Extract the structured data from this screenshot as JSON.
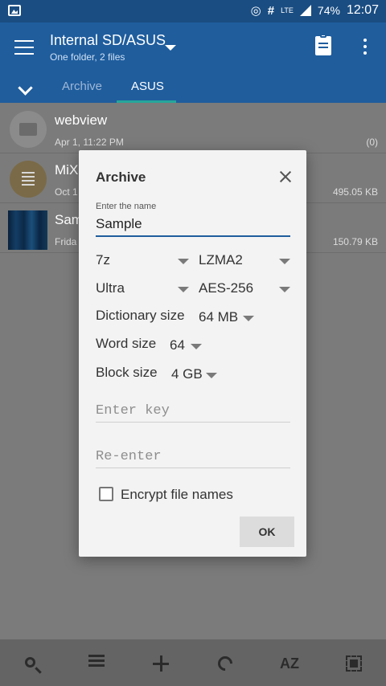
{
  "status_bar": {
    "battery": "74%",
    "time": "12:07",
    "network": "LTE",
    "indicators": [
      "wifi-hotspot-icon",
      "hash-icon",
      "signal-icon"
    ]
  },
  "app_bar": {
    "title": "Internal SD/ASUS",
    "subtitle": "One folder, 2 files",
    "tabs": [
      {
        "label": "Archive"
      },
      {
        "label": "ASUS",
        "active": true
      }
    ]
  },
  "file_list": [
    {
      "name": "webview",
      "meta": "Apr 1, 11:22 PM",
      "size": "(0)"
    },
    {
      "name": "MiX",
      "meta": "Oct 1",
      "size": "495.05 KB"
    },
    {
      "name": "Sam",
      "meta": "Frida",
      "size": "150.79 KB"
    }
  ],
  "dialog": {
    "title": "Archive",
    "name_label": "Enter the name",
    "name_value": "Sample",
    "format": "7z",
    "method": "LZMA2",
    "level": "Ultra",
    "encryption": "AES-256",
    "dictionary_label": "Dictionary size",
    "dictionary_value": "64 MB",
    "word_label": "Word size",
    "word_value": "64",
    "block_label": "Block size",
    "block_value": "4 GB",
    "key_placeholder": "Enter key",
    "reenter_placeholder": "Re-enter",
    "checkbox_label": "Encrypt file names",
    "ok_label": "OK"
  },
  "bottom_bar": {
    "sort_label": "AZ"
  },
  "colors": {
    "accent": "#1f5d9d",
    "status_bar": "#1a4d82",
    "tab_indicator": "#26a69a"
  }
}
